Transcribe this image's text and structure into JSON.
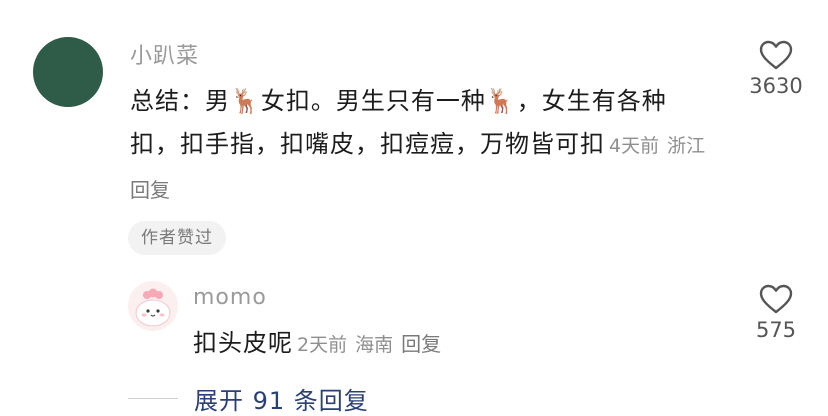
{
  "comment": {
    "author": "小趴菜",
    "text_parts": [
      "总结：男",
      "女扣。男生只有一种",
      "，女生有各种扣，扣手指，扣嘴皮，扣痘痘，万物皆可扣"
    ],
    "emoji": "🦌",
    "time": "4天前",
    "location": "浙江",
    "reply_label": "回复",
    "like_count": "3630",
    "author_liked_label": "作者赞过"
  },
  "reply": {
    "author": "momo",
    "text": "扣头皮呢",
    "time": "2天前",
    "location": "海南",
    "reply_label": "回复",
    "like_count": "575"
  },
  "expand": {
    "label": "展开 91 条回复"
  },
  "colors": {
    "avatar_main": "#2f5c49",
    "expand_link": "#2a3f75"
  },
  "icons": {
    "like": "heart-outline-icon",
    "avatar_reply": "pink-cartoon-avatar"
  }
}
